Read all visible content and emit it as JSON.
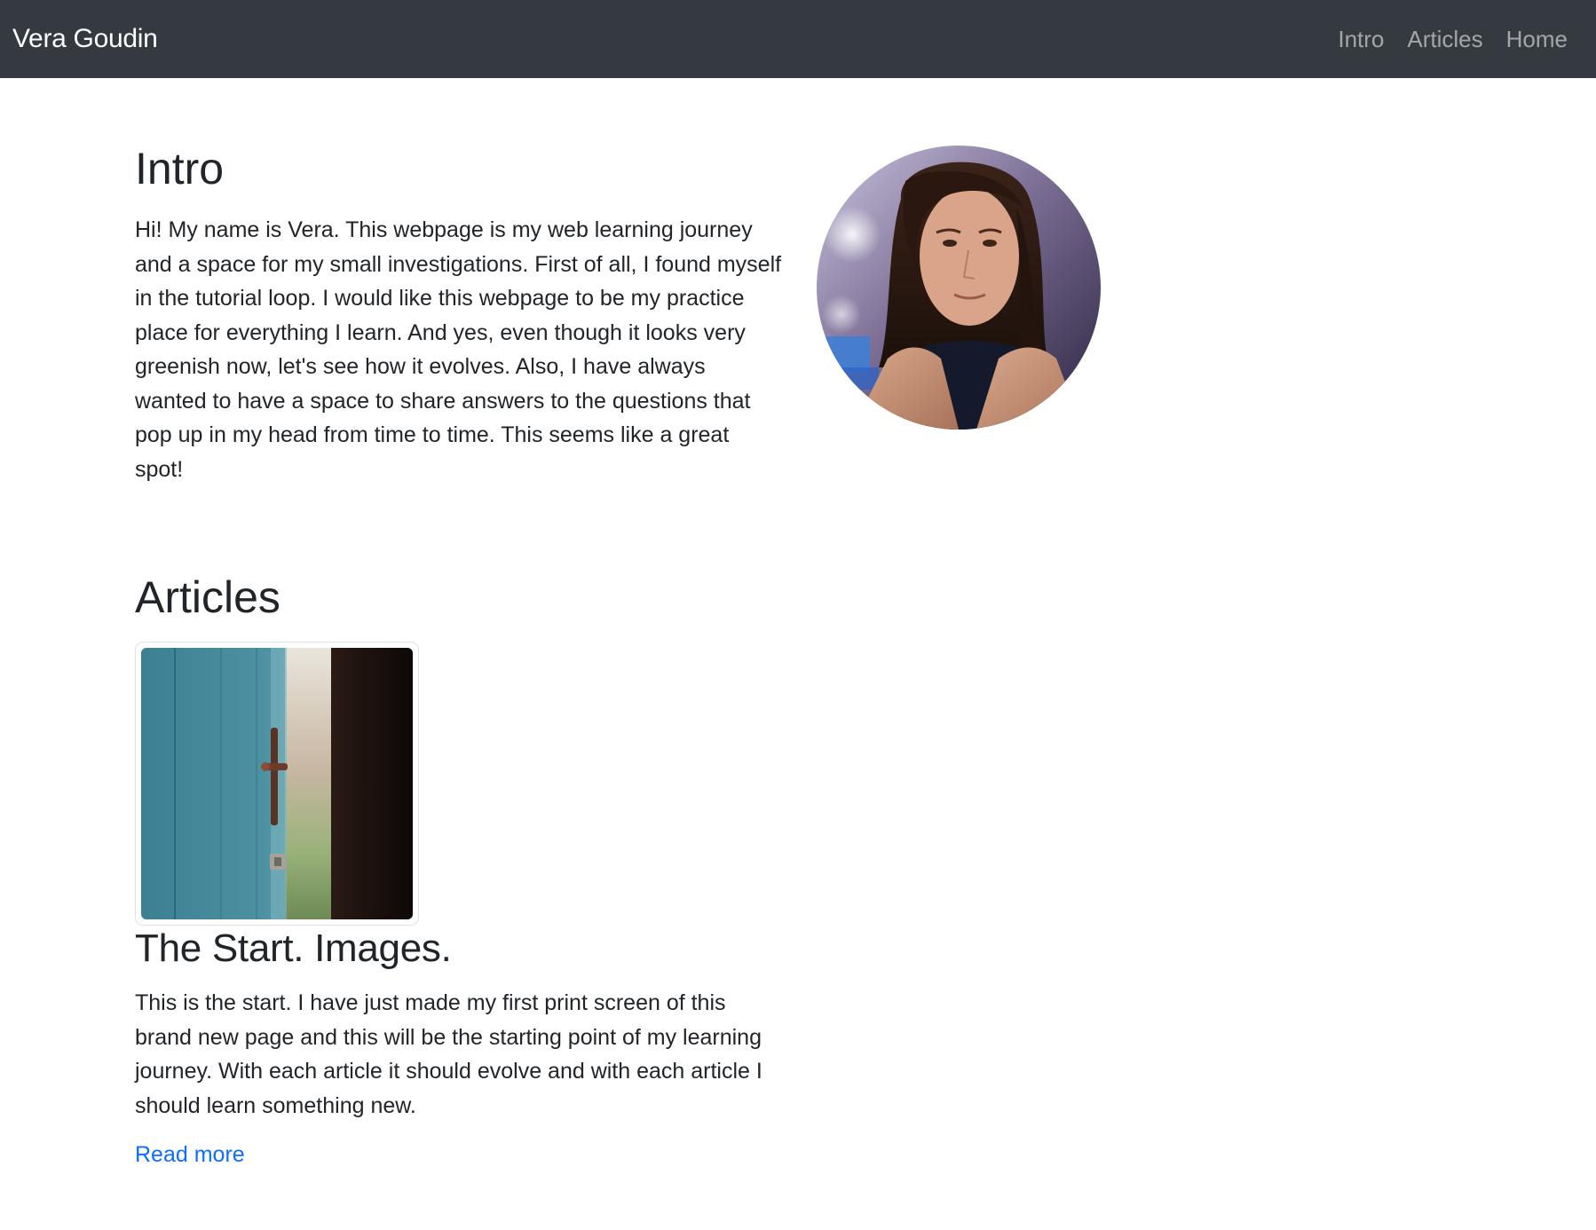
{
  "navbar": {
    "brand": "Vera Goudin",
    "links": [
      {
        "label": "Intro"
      },
      {
        "label": "Articles"
      },
      {
        "label": "Home"
      }
    ]
  },
  "intro": {
    "heading": "Intro",
    "text": "Hi! My name is Vera. This webpage is my web learning journey and a space for my small investigations. First of all, I found myself in the tutorial loop. I would like this webpage to be my practice place for everything I learn. And yes, even though it looks very greenish now, let's see how it evolves. Also, I have always wanted to have a space to share answers to the questions that pop up in my head from time to time. This seems like a great spot!"
  },
  "articles": {
    "heading": "Articles",
    "items": [
      {
        "title": "The Start. Images.",
        "text": "This is the start. I have just made my first print screen of this brand new page and this will be the starting point of my learning journey. With each article it should evolve and with each article I should learn something new.",
        "link_label": "Read more"
      }
    ]
  },
  "colors": {
    "navbar_bg": "#343a40",
    "link": "#0d6efd",
    "text": "#212529"
  }
}
